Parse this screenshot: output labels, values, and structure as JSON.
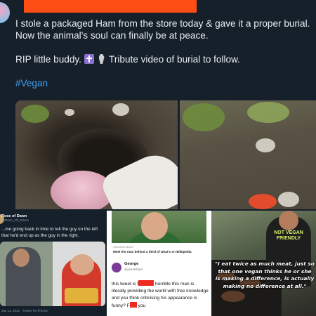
{
  "tweet": {
    "line1": "I stole a packaged Ham from the store today & gave it a proper burial.",
    "line2": "Now the animal's soul can finally be at peace.",
    "rip_text": "RIP little buddy.",
    "tribute_text": "Tribute video of burial to follow.",
    "icons": [
      "latin-cross-icon",
      "coffin-icon"
    ],
    "hashtag": "#Vegan",
    "colors": {
      "background": "#16202b",
      "text": "#e9eef2",
      "hashtag": "#3ea2f5",
      "censor": "#ff4e14"
    }
  },
  "panel_left": {
    "name": "Rose of Dawn",
    "handle": "@Rose_Of_Dawn",
    "text": "...me going back in time to tell the guy on the left that he'd end up as the guy in the right.",
    "date": "Jan 11, 2021 · Twitter for iPhone"
  },
  "panel_middle": {
    "source": "CHICAGO BUZZ",
    "headline": "Meet the man behind a third of what's on Wikipedia",
    "name": "George",
    "handle": "@geordelriper",
    "text_before": "this tweet is f",
    "text_middle": "horrible this man is literally providing the world with free knowledge and you think criticising his appearance is funny? F",
    "text_after": "you",
    "colors": {
      "redaction": "#ef2a23"
    }
  },
  "panel_right": {
    "shirt_text": "NOT VEGAN FRIENDLY",
    "quote": "\"I eat twice as much meat, just so that one vegan thinks he or she is making a difference, is actually making no difference at all.\""
  }
}
